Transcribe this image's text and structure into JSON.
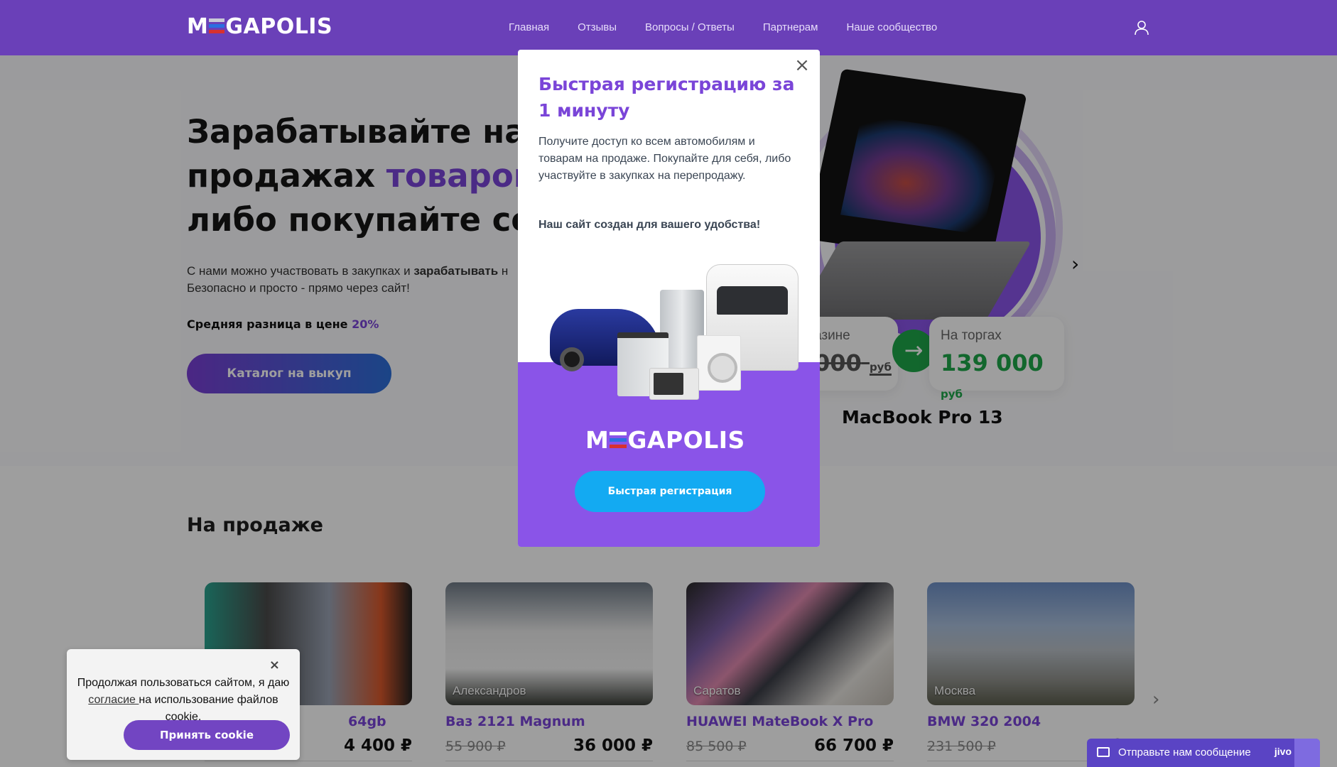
{
  "header": {
    "logo": {
      "pre": "M",
      "post": "GAPOLIS"
    },
    "nav": [
      "Главная",
      "Отзывы",
      "Вопросы / Ответы",
      "Партнерам",
      "Наше сообщество"
    ]
  },
  "hero": {
    "title_line1": "Зарабатывайте на",
    "title_line2_plain": "продажах ",
    "title_line2_accent": "товаров и",
    "title_line3": "либо покупайте себ",
    "sub_plain1": "С нами можно участвовать в закупках и ",
    "sub_bold": "зарабатывать",
    "sub_plain2": " н",
    "sub_line2": "Безопасно и просто - прямо через сайт!",
    "diff_label": "Средняя разница в цене ",
    "diff_value": "20%",
    "catalog_button": "Каталог на выкуп",
    "store_label": "азине",
    "store_value": "000",
    "store_unit": "руб",
    "auction_label": "На торгах",
    "auction_value": "139 000",
    "auction_unit": "руб",
    "product_name": "MacBook Pro 13",
    "colors": {
      "accent": "#7a45d8",
      "auction_green": "#1ea64a"
    }
  },
  "sale": {
    "title": "На продаже",
    "cards": [
      {
        "city": "",
        "name": "64gb",
        "old": "",
        "new": "4 400 ₽"
      },
      {
        "city": "Александров",
        "name": "Ваз 2121 Magnum",
        "old": "55 900 ₽",
        "new": "36 000 ₽"
      },
      {
        "city": "Саратов",
        "name": "HUAWEI MateBook X Pro",
        "old": "85 500 ₽",
        "new": "66 700 ₽"
      },
      {
        "city": "Москва",
        "name": "BMW 320 2004",
        "old": "231 500 ₽",
        "new": "185"
      }
    ]
  },
  "modal": {
    "title": "Быстрая регистрацию за 1 минуту",
    "text": "Получите доступ ко всем автомобилям и товарам на продаже. Покупайте для себя, либо участвуйте в закупках на перепродажу.",
    "strong": "Наш сайт создан для вашего удобства!",
    "logo": {
      "pre": "M",
      "post": "GAPOLIS"
    },
    "button": "Быстрая регистрация",
    "close_icon": "close-icon"
  },
  "cookie": {
    "text_before": "Продолжая пользоваться сайтом, я даю ",
    "link": "согласие ",
    "text_after": "на использование файлов cookie.",
    "button": "Принять cookie",
    "close": "×"
  },
  "chat": {
    "text": "Отправьте нам сообщение",
    "brand": "jivo"
  }
}
